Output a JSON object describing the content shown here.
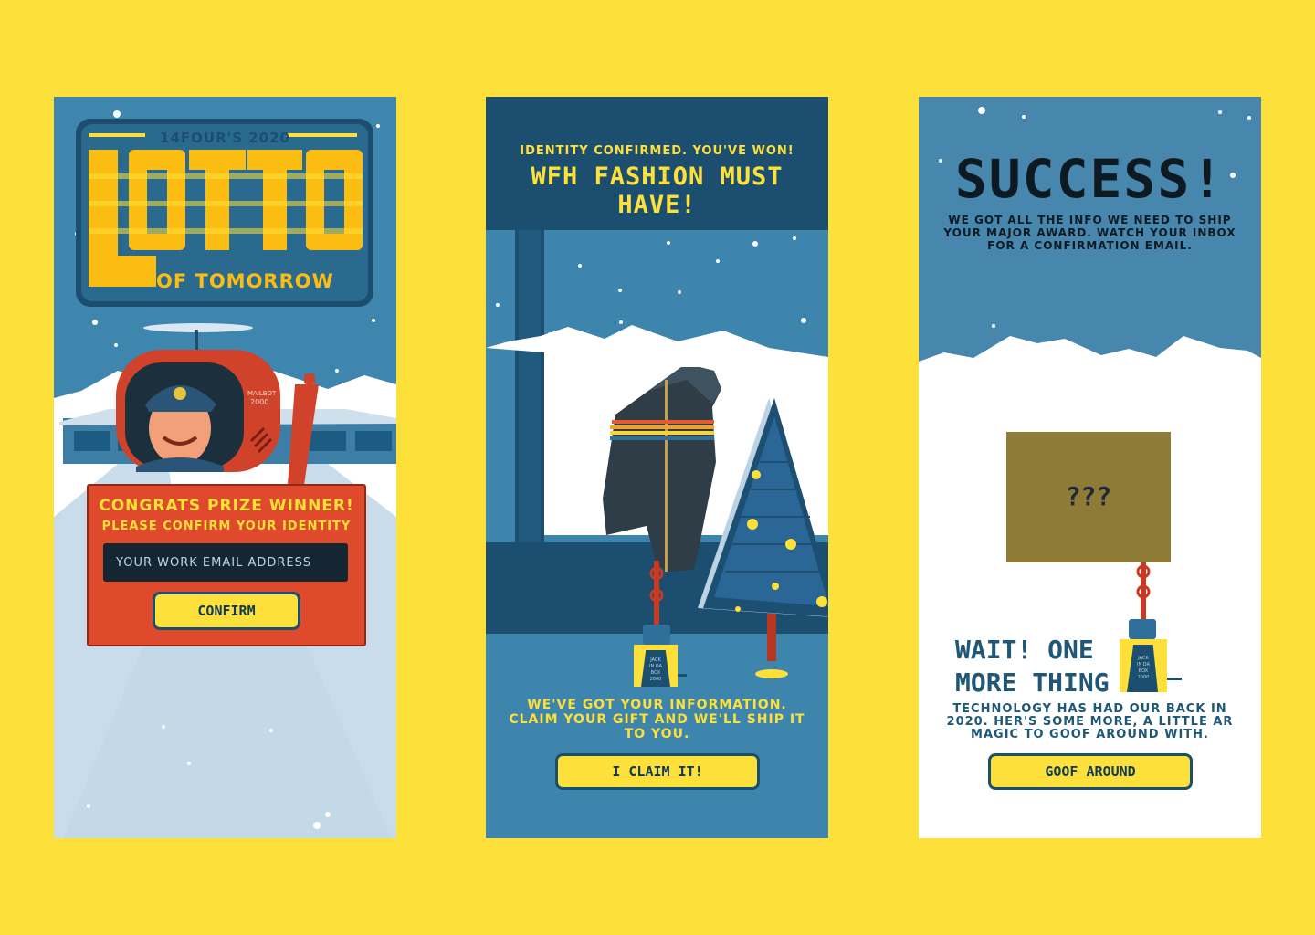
{
  "colors": {
    "background": "#fde03a",
    "accent": "#fde03a",
    "dark_blue": "#1c4f6f",
    "red": "#df4a2c"
  },
  "screens": [
    {
      "logo": {
        "top": "14FOUR'S 2020",
        "word": "LOTTO",
        "sub": "OF TOMORROW"
      },
      "robot_label": [
        "MAILBOT",
        "2000"
      ],
      "card": {
        "title": "CONGRATS PRIZE WINNER!",
        "subtitle": "PLEASE CONFIRM YOUR IDENTITY",
        "email_placeholder": "YOUR WORK EMAIL ADDRESS",
        "button": "CONFIRM"
      }
    },
    {
      "heading_small": "IDENTITY CONFIRMED. YOU'VE WON!",
      "heading_large": "WFH FASHION MUST HAVE!",
      "jack_label": [
        "JACK",
        "IN DA",
        "BOX",
        "2000"
      ],
      "message": "WE'VE GOT YOUR INFORMATION. CLAIM YOUR GIFT AND WE'LL SHIP IT TO YOU.",
      "button": "I CLAIM IT!"
    },
    {
      "title": "SUCCESS!",
      "subtitle": "WE GOT ALL THE INFO WE NEED TO SHIP YOUR MAJOR AWARD. WATCH YOUR INBOX FOR A CONFIRMATION EMAIL.",
      "box_text": "???",
      "jack_label": [
        "JACK",
        "IN DA",
        "BOX",
        "2000"
      ],
      "heading": "WAIT! ONE MORE THING",
      "message": "TECHNOLOGY HAS HAD OUR BACK IN 2020. HER'S SOME MORE, A LITTLE AR MAGIC TO GOOF AROUND WITH.",
      "button": "GOOF AROUND"
    }
  ]
}
